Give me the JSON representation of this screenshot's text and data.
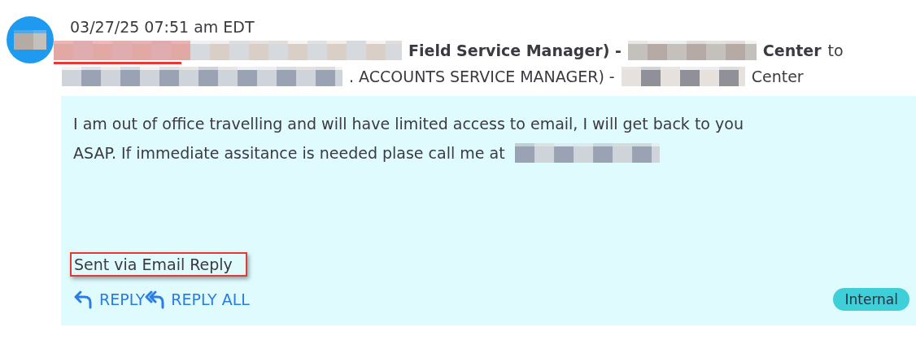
{
  "timestamp": "03/27/25 07:51 am EDT",
  "from_line": [
    {
      "kind": "redacted",
      "underlined": true
    },
    {
      "kind": "text",
      "text": "Field Service Manager) -",
      "bold": true
    },
    {
      "kind": "redacted",
      "underlined": false
    },
    {
      "kind": "text",
      "text": "Center",
      "bold": true
    },
    {
      "kind": "text",
      "text": "to",
      "bold": false
    }
  ],
  "to_line": [
    {
      "kind": "redacted",
      "underlined": false
    },
    {
      "kind": "text",
      "text": ". ACCOUNTS SERVICE MANAGER) -",
      "bold": false
    },
    {
      "kind": "redacted",
      "underlined": false
    },
    {
      "kind": "text",
      "text": "Center",
      "bold": false
    }
  ],
  "message": {
    "lines": [
      "I am out of office travelling and will have limited access to email, I will get back to you",
      "ASAP. If immediate assitance is needed plase call me at"
    ],
    "footer": {
      "text": "Sent via Email Reply",
      "annotated": true
    },
    "actions": [
      {
        "kind": "reply",
        "label": "REPLY"
      },
      {
        "kind": "reply_all",
        "label": "REPLY ALL"
      }
    ],
    "tag": "Internal"
  }
}
